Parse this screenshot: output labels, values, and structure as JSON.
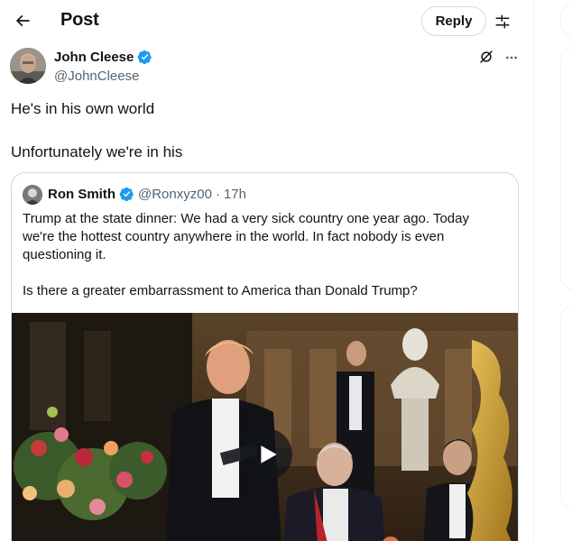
{
  "header": {
    "title": "Post",
    "reply_label": "Reply",
    "back_icon": "back-arrow-icon",
    "filter_icon": "sliders-icon"
  },
  "post": {
    "author_name": "John Cleese",
    "author_handle": "@JohnCleese",
    "verified": true,
    "lines": [
      "He's in his own world",
      "Unfortunately we're in his"
    ]
  },
  "quote": {
    "author_name": "Ron Smith",
    "author_handle": "@Ronxyz00",
    "separator": "·",
    "time": "17h",
    "verified": true,
    "paragraphs": [
      "Trump at the state dinner: We had a very sick country one year ago. Today we're the hottest country anywhere in the world. In fact nobody is even questioning it.",
      "Is there a greater embarrassment to America than Donald Trump?"
    ],
    "media_type": "video"
  },
  "colors": {
    "text": "#0f1419",
    "secondary": "#536471",
    "verified_blue": "#1d9bf0",
    "border": "#cfd9de"
  }
}
